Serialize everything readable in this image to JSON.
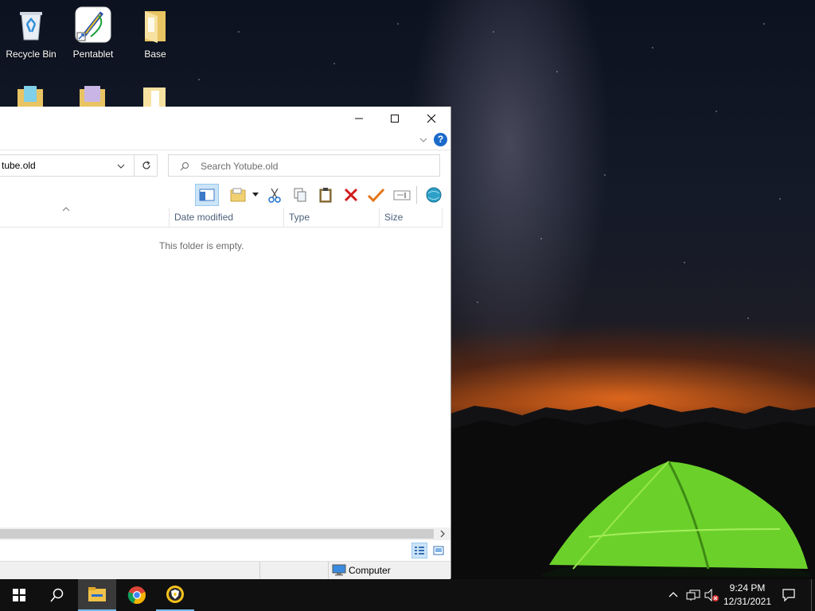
{
  "desktop": {
    "icons": [
      {
        "label": "Recycle Bin",
        "icon": "recycle-bin-icon"
      },
      {
        "label": "Pentablet",
        "icon": "pentablet-app-icon"
      },
      {
        "label": "Base",
        "icon": "folder-icon"
      }
    ]
  },
  "explorer": {
    "address_text": "tube.old",
    "search_placeholder": "Search Yotube.old",
    "columns": [
      "Date modified",
      "Type",
      "Size"
    ],
    "empty_message": "This folder is empty.",
    "status_location": "Computer",
    "help_symbol": "?"
  },
  "taskbar": {
    "time": "9:24 PM",
    "date": "12/31/2021"
  }
}
